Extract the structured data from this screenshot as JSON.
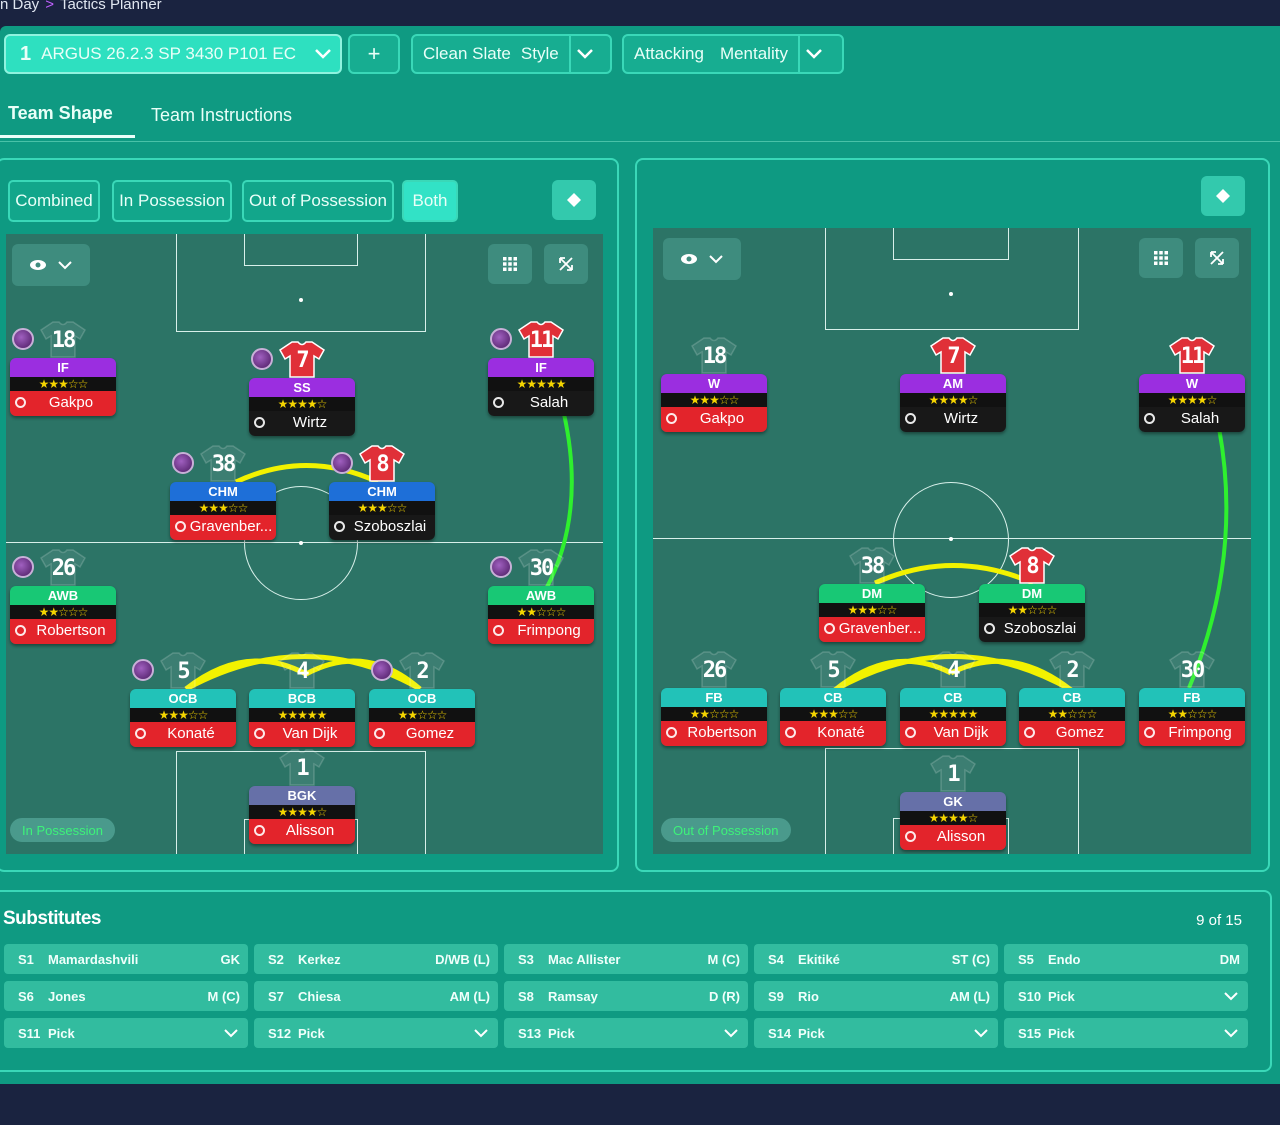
{
  "breadcrumb": {
    "prev": "n Day",
    "current": "Tactics Planner"
  },
  "toolbar": {
    "slot_number": "1",
    "tactic_name": "ARGUS 26.2.3 SP 3430 P101 EC",
    "add_label": "+",
    "style_value": "Clean Slate",
    "style_label": "Style",
    "mentality_value": "Attacking",
    "mentality_label": "Mentality"
  },
  "tabs": [
    "Team Shape",
    "Team Instructions"
  ],
  "modes": [
    "Combined",
    "In Possession",
    "Out of Possession",
    "Both"
  ],
  "left_panel": {
    "pill": "In Possession"
  },
  "right_panel": {
    "pill": "Out of Possession"
  },
  "colors": {
    "accent": "#2ee0c0",
    "panel": "#0f9a82",
    "pitch": "#2c7466",
    "star": "#f4d400",
    "link_yellow": "#f2f200",
    "link_green": "#2ef02e"
  },
  "left_players": [
    {
      "num": "18",
      "role": "IF",
      "stars": "★★★☆☆",
      "name": "Gakpo",
      "role_color": "purple",
      "name_color": "red",
      "shirt": false,
      "orb": true
    },
    {
      "num": "7",
      "role": "SS",
      "stars": "★★★★☆",
      "name": "Wirtz",
      "role_color": "purple",
      "name_color": "black",
      "shirt": true,
      "orb": true
    },
    {
      "num": "11",
      "role": "IF",
      "stars": "★★★★★",
      "name": "Salah",
      "role_color": "purple",
      "name_color": "black",
      "shirt": true,
      "orb": true
    },
    {
      "num": "38",
      "role": "CHM",
      "stars": "★★★☆☆",
      "name": "Gravenber...",
      "role_color": "blue",
      "name_color": "red",
      "shirt": false,
      "orb": true
    },
    {
      "num": "8",
      "role": "CHM",
      "stars": "★★★☆☆",
      "name": "Szoboszlai",
      "role_color": "blue",
      "name_color": "black",
      "shirt": true,
      "orb": true
    },
    {
      "num": "26",
      "role": "AWB",
      "stars": "★★☆☆☆",
      "name": "Robertson",
      "role_color": "green",
      "name_color": "red",
      "shirt": false,
      "orb": true
    },
    {
      "num": "30",
      "role": "AWB",
      "stars": "★★☆☆☆",
      "name": "Frimpong",
      "role_color": "green",
      "name_color": "red",
      "shirt": false,
      "orb": true
    },
    {
      "num": "5",
      "role": "OCB",
      "stars": "★★★☆☆",
      "name": "Konaté",
      "role_color": "teal",
      "name_color": "red",
      "shirt": false,
      "orb": true
    },
    {
      "num": "4",
      "role": "BCB",
      "stars": "★★★★★",
      "name": "Van Dijk",
      "role_color": "teal",
      "name_color": "red",
      "shirt": false,
      "orb": false
    },
    {
      "num": "2",
      "role": "OCB",
      "stars": "★★☆☆☆",
      "name": "Gomez",
      "role_color": "teal",
      "name_color": "red",
      "shirt": false,
      "orb": true
    },
    {
      "num": "1",
      "role": "BGK",
      "stars": "★★★★☆",
      "name": "Alisson",
      "role_color": "grey",
      "name_color": "red",
      "shirt": false,
      "orb": false
    }
  ],
  "right_players": [
    {
      "num": "18",
      "role": "W",
      "stars": "★★★☆☆",
      "name": "Gakpo",
      "role_color": "purple",
      "name_color": "red",
      "shirt": false,
      "orb": false
    },
    {
      "num": "7",
      "role": "AM",
      "stars": "★★★★☆",
      "name": "Wirtz",
      "role_color": "purple",
      "name_color": "black",
      "shirt": true,
      "orb": false
    },
    {
      "num": "11",
      "role": "W",
      "stars": "★★★★☆",
      "name": "Salah",
      "role_color": "purple",
      "name_color": "black",
      "shirt": true,
      "orb": false
    },
    {
      "num": "38",
      "role": "DM",
      "stars": "★★★☆☆",
      "name": "Gravenber...",
      "role_color": "green",
      "name_color": "red",
      "shirt": false,
      "orb": false
    },
    {
      "num": "8",
      "role": "DM",
      "stars": "★★☆☆☆",
      "name": "Szoboszlai",
      "role_color": "green",
      "name_color": "black",
      "shirt": true,
      "orb": false
    },
    {
      "num": "26",
      "role": "FB",
      "stars": "★★☆☆☆",
      "name": "Robertson",
      "role_color": "teal",
      "name_color": "red",
      "shirt": false,
      "orb": false
    },
    {
      "num": "5",
      "role": "CB",
      "stars": "★★★☆☆",
      "name": "Konaté",
      "role_color": "teal",
      "name_color": "red",
      "shirt": false,
      "orb": false
    },
    {
      "num": "4",
      "role": "CB",
      "stars": "★★★★★",
      "name": "Van Dijk",
      "role_color": "teal",
      "name_color": "red",
      "shirt": false,
      "orb": false
    },
    {
      "num": "2",
      "role": "CB",
      "stars": "★★☆☆☆",
      "name": "Gomez",
      "role_color": "teal",
      "name_color": "red",
      "shirt": false,
      "orb": false
    },
    {
      "num": "30",
      "role": "FB",
      "stars": "★★☆☆☆",
      "name": "Frimpong",
      "role_color": "teal",
      "name_color": "red",
      "shirt": false,
      "orb": false
    },
    {
      "num": "1",
      "role": "GK",
      "stars": "★★★★☆",
      "name": "Alisson",
      "role_color": "grey",
      "name_color": "red",
      "shirt": false,
      "orb": false
    }
  ],
  "substitutes": {
    "title": "Substitutes",
    "count": "9 of 15",
    "slots": [
      {
        "id": "S1",
        "name": "Mamardashvili",
        "pos": "GK"
      },
      {
        "id": "S2",
        "name": "Kerkez",
        "pos": "D/WB (L)"
      },
      {
        "id": "S3",
        "name": "Mac Allister",
        "pos": "M (C)"
      },
      {
        "id": "S4",
        "name": "Ekitiké",
        "pos": "ST (C)"
      },
      {
        "id": "S5",
        "name": "Endo",
        "pos": "DM"
      },
      {
        "id": "S6",
        "name": "Jones",
        "pos": "M (C)"
      },
      {
        "id": "S7",
        "name": "Chiesa",
        "pos": "AM (L)"
      },
      {
        "id": "S8",
        "name": "Ramsay",
        "pos": "D (R)"
      },
      {
        "id": "S9",
        "name": "Rio",
        "pos": "AM (L)"
      },
      {
        "id": "S10",
        "name": "Pick",
        "pos": ""
      },
      {
        "id": "S11",
        "name": "Pick",
        "pos": ""
      },
      {
        "id": "S12",
        "name": "Pick",
        "pos": ""
      },
      {
        "id": "S13",
        "name": "Pick",
        "pos": ""
      },
      {
        "id": "S14",
        "name": "Pick",
        "pos": ""
      },
      {
        "id": "S15",
        "name": "Pick",
        "pos": ""
      }
    ]
  }
}
